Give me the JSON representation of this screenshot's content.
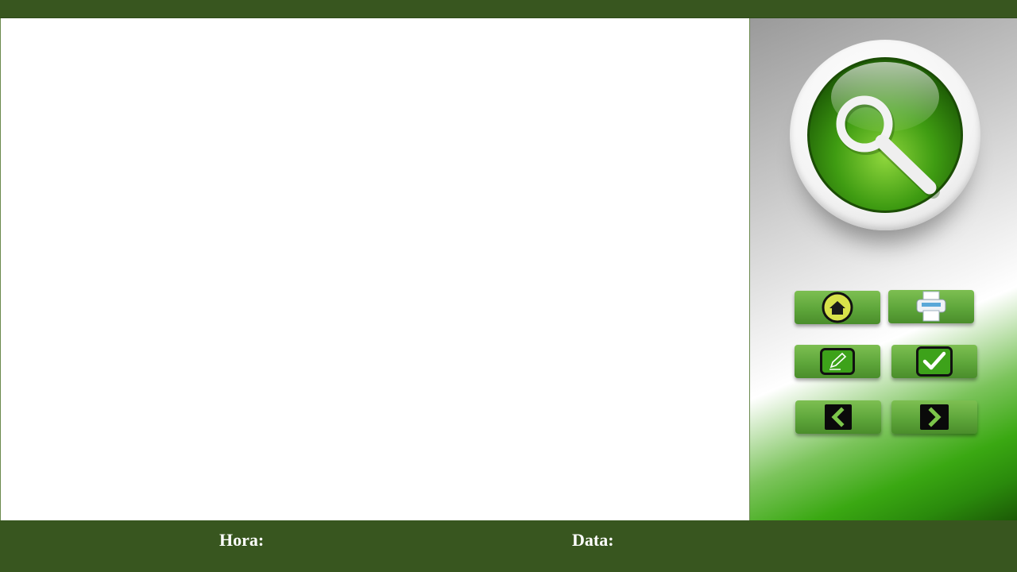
{
  "footer": {
    "time_label": "Hora:",
    "date_label": "Data:"
  },
  "icons": {
    "search": "search-icon",
    "home": "home-icon",
    "print": "printer-icon",
    "edit": "pencil-icon",
    "confirm": "checkmark-icon",
    "back": "chevron-left-icon",
    "forward": "chevron-right-icon"
  },
  "colors": {
    "header_footer": "#38561f",
    "button_green": "#5ea63a",
    "search_green": "#3c9a12"
  }
}
